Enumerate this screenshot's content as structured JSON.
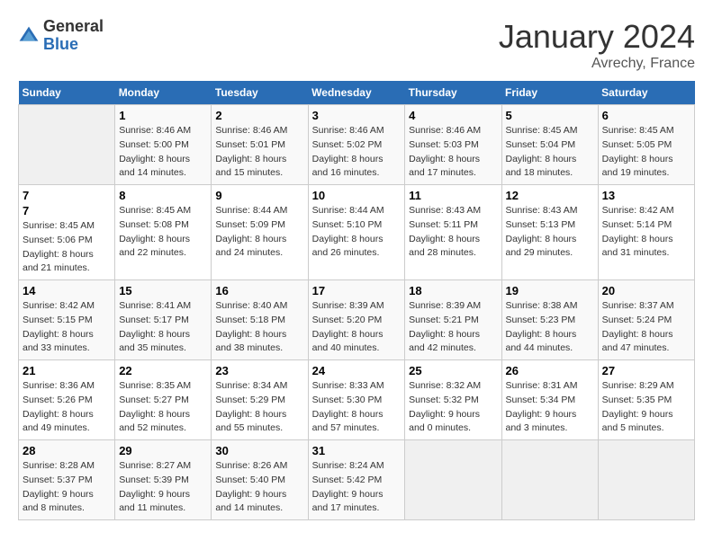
{
  "header": {
    "logo_general": "General",
    "logo_blue": "Blue",
    "month": "January 2024",
    "location": "Avrechy, France"
  },
  "weekdays": [
    "Sunday",
    "Monday",
    "Tuesday",
    "Wednesday",
    "Thursday",
    "Friday",
    "Saturday"
  ],
  "weeks": [
    [
      {
        "day": "",
        "info": ""
      },
      {
        "day": "1",
        "info": "Sunrise: 8:46 AM\nSunset: 5:00 PM\nDaylight: 8 hours\nand 14 minutes."
      },
      {
        "day": "2",
        "info": "Sunrise: 8:46 AM\nSunset: 5:01 PM\nDaylight: 8 hours\nand 15 minutes."
      },
      {
        "day": "3",
        "info": "Sunrise: 8:46 AM\nSunset: 5:02 PM\nDaylight: 8 hours\nand 16 minutes."
      },
      {
        "day": "4",
        "info": "Sunrise: 8:46 AM\nSunset: 5:03 PM\nDaylight: 8 hours\nand 17 minutes."
      },
      {
        "day": "5",
        "info": "Sunrise: 8:45 AM\nSunset: 5:04 PM\nDaylight: 8 hours\nand 18 minutes."
      },
      {
        "day": "6",
        "info": "Sunrise: 8:45 AM\nSunset: 5:05 PM\nDaylight: 8 hours\nand 19 minutes."
      }
    ],
    [
      {
        "day": "7",
        "info": ""
      },
      {
        "day": "8",
        "info": "Sunrise: 8:45 AM\nSunset: 5:08 PM\nDaylight: 8 hours\nand 22 minutes."
      },
      {
        "day": "9",
        "info": "Sunrise: 8:44 AM\nSunset: 5:09 PM\nDaylight: 8 hours\nand 24 minutes."
      },
      {
        "day": "10",
        "info": "Sunrise: 8:44 AM\nSunset: 5:10 PM\nDaylight: 8 hours\nand 26 minutes."
      },
      {
        "day": "11",
        "info": "Sunrise: 8:43 AM\nSunset: 5:11 PM\nDaylight: 8 hours\nand 28 minutes."
      },
      {
        "day": "12",
        "info": "Sunrise: 8:43 AM\nSunset: 5:13 PM\nDaylight: 8 hours\nand 29 minutes."
      },
      {
        "day": "13",
        "info": "Sunrise: 8:42 AM\nSunset: 5:14 PM\nDaylight: 8 hours\nand 31 minutes."
      }
    ],
    [
      {
        "day": "14",
        "info": "Sunrise: 8:42 AM\nSunset: 5:15 PM\nDaylight: 8 hours\nand 33 minutes."
      },
      {
        "day": "15",
        "info": "Sunrise: 8:41 AM\nSunset: 5:17 PM\nDaylight: 8 hours\nand 35 minutes."
      },
      {
        "day": "16",
        "info": "Sunrise: 8:40 AM\nSunset: 5:18 PM\nDaylight: 8 hours\nand 38 minutes."
      },
      {
        "day": "17",
        "info": "Sunrise: 8:39 AM\nSunset: 5:20 PM\nDaylight: 8 hours\nand 40 minutes."
      },
      {
        "day": "18",
        "info": "Sunrise: 8:39 AM\nSunset: 5:21 PM\nDaylight: 8 hours\nand 42 minutes."
      },
      {
        "day": "19",
        "info": "Sunrise: 8:38 AM\nSunset: 5:23 PM\nDaylight: 8 hours\nand 44 minutes."
      },
      {
        "day": "20",
        "info": "Sunrise: 8:37 AM\nSunset: 5:24 PM\nDaylight: 8 hours\nand 47 minutes."
      }
    ],
    [
      {
        "day": "21",
        "info": "Sunrise: 8:36 AM\nSunset: 5:26 PM\nDaylight: 8 hours\nand 49 minutes."
      },
      {
        "day": "22",
        "info": "Sunrise: 8:35 AM\nSunset: 5:27 PM\nDaylight: 8 hours\nand 52 minutes."
      },
      {
        "day": "23",
        "info": "Sunrise: 8:34 AM\nSunset: 5:29 PM\nDaylight: 8 hours\nand 55 minutes."
      },
      {
        "day": "24",
        "info": "Sunrise: 8:33 AM\nSunset: 5:30 PM\nDaylight: 8 hours\nand 57 minutes."
      },
      {
        "day": "25",
        "info": "Sunrise: 8:32 AM\nSunset: 5:32 PM\nDaylight: 9 hours\nand 0 minutes."
      },
      {
        "day": "26",
        "info": "Sunrise: 8:31 AM\nSunset: 5:34 PM\nDaylight: 9 hours\nand 3 minutes."
      },
      {
        "day": "27",
        "info": "Sunrise: 8:29 AM\nSunset: 5:35 PM\nDaylight: 9 hours\nand 5 minutes."
      }
    ],
    [
      {
        "day": "28",
        "info": "Sunrise: 8:28 AM\nSunset: 5:37 PM\nDaylight: 9 hours\nand 8 minutes."
      },
      {
        "day": "29",
        "info": "Sunrise: 8:27 AM\nSunset: 5:39 PM\nDaylight: 9 hours\nand 11 minutes."
      },
      {
        "day": "30",
        "info": "Sunrise: 8:26 AM\nSunset: 5:40 PM\nDaylight: 9 hours\nand 14 minutes."
      },
      {
        "day": "31",
        "info": "Sunrise: 8:24 AM\nSunset: 5:42 PM\nDaylight: 9 hours\nand 17 minutes."
      },
      {
        "day": "",
        "info": ""
      },
      {
        "day": "",
        "info": ""
      },
      {
        "day": "",
        "info": ""
      }
    ]
  ],
  "week2_sunday": "Sunrise: 8:45 AM\nSunset: 5:06 PM\nDaylight: 8 hours\nand 21 minutes."
}
